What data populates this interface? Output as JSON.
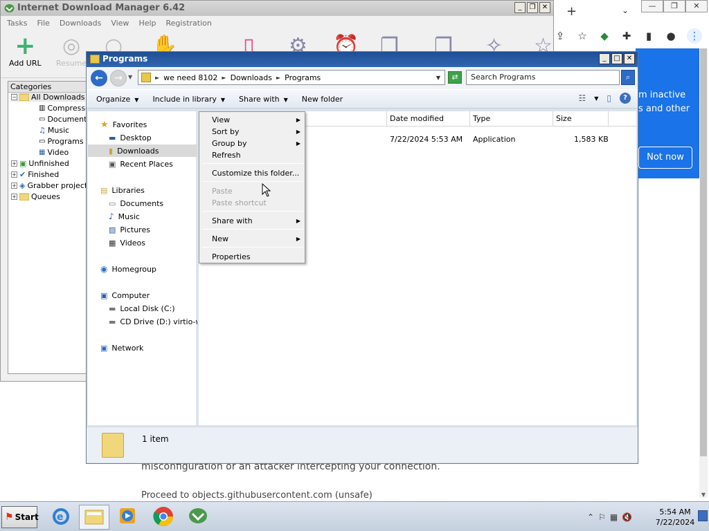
{
  "chrome": {
    "new_tab": "+",
    "tab_menu": "⌄",
    "win_min": "—",
    "win_max": "❐",
    "win_close": "✕",
    "share_icon": "⇪",
    "star_icon": "☆",
    "bubble_line1": "m inactive",
    "bubble_line2": "s and other",
    "not_now": "Not now",
    "page_line1": "misconfiguration or an attacker intercepting your connection.",
    "page_line2": "Proceed to objects.githubusercontent.com (unsafe)",
    "accent": "#1a73e8"
  },
  "idm": {
    "title": "Internet Download Manager 6.42",
    "btn_min": "_",
    "btn_restore": "❐",
    "btn_close": "✕",
    "menu": [
      "Tasks",
      "File",
      "Downloads",
      "View",
      "Help",
      "Registration"
    ],
    "tools": {
      "add_url": "Add URL",
      "resume": "Resume"
    },
    "categories_header": "Categories",
    "categories": [
      {
        "label": "All Downloads"
      },
      {
        "label": "Compressed"
      },
      {
        "label": "Documents"
      },
      {
        "label": "Music"
      },
      {
        "label": "Programs"
      },
      {
        "label": "Video"
      },
      {
        "label": "Unfinished"
      },
      {
        "label": "Finished"
      },
      {
        "label": "Grabber projects"
      },
      {
        "label": "Queues"
      }
    ]
  },
  "explorer": {
    "title": "Programs",
    "btn_min": "_",
    "btn_max": "□",
    "btn_close": "✕",
    "breadcrumb": [
      "we need 8102",
      "Downloads",
      "Programs"
    ],
    "search_placeholder": "Search Programs",
    "commands": {
      "organize": "Organize",
      "include": "Include in library",
      "share": "Share with",
      "new_folder": "New folder"
    },
    "nav": {
      "favorites": "Favorites",
      "desktop": "Desktop",
      "downloads": "Downloads",
      "recent": "Recent Places",
      "libraries": "Libraries",
      "documents": "Documents",
      "music": "Music",
      "pictures": "Pictures",
      "videos": "Videos",
      "homegroup": "Homegroup",
      "computer": "Computer",
      "local_disk": "Local Disk (C:)",
      "cd_drive": "CD Drive (D:) virtio-win",
      "network": "Network"
    },
    "columns": {
      "date": "Date modified",
      "type": "Type",
      "size": "Size"
    },
    "file": {
      "date": "7/22/2024 5:53 AM",
      "type": "Application",
      "size": "1,583 KB"
    },
    "item_count": "1 item"
  },
  "context_menu": {
    "view": "View",
    "sort_by": "Sort by",
    "group_by": "Group by",
    "refresh": "Refresh",
    "customize": "Customize this folder...",
    "paste": "Paste",
    "paste_shortcut": "Paste shortcut",
    "share_with": "Share with",
    "new": "New",
    "properties": "Properties"
  },
  "taskbar": {
    "start": "Start",
    "time": "5:54 AM",
    "date": "7/22/2024"
  }
}
